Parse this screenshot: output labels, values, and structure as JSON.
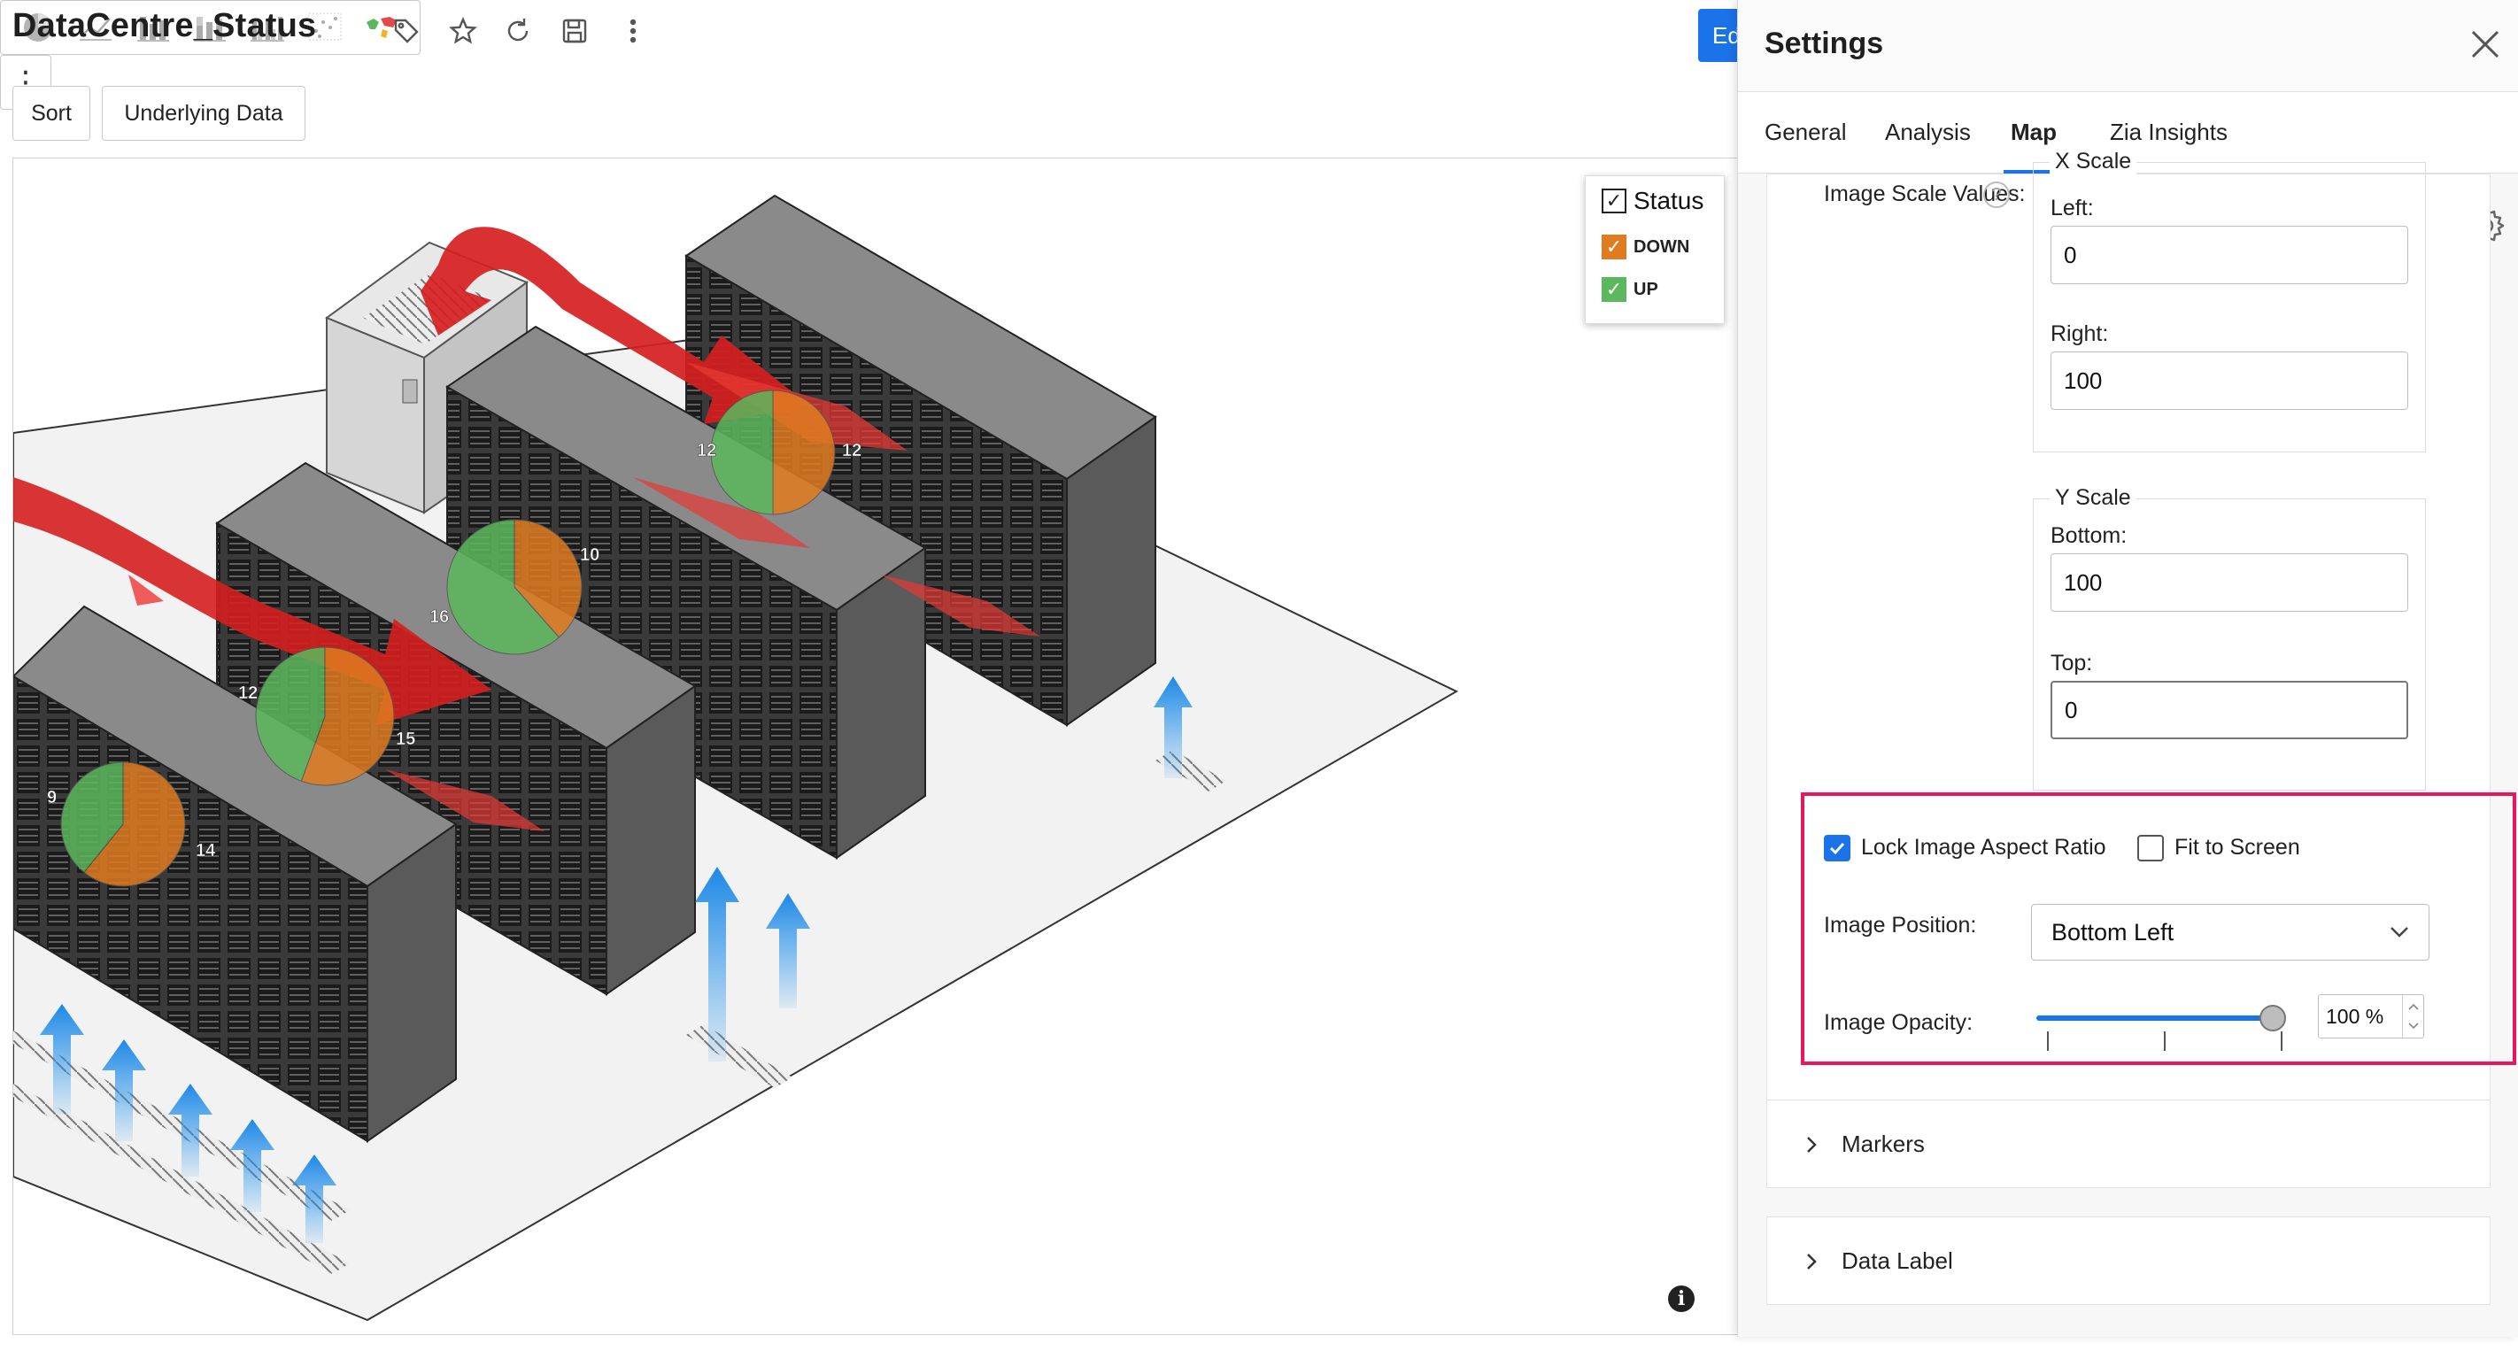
{
  "report": {
    "title": "DataCentre_Status",
    "toolbar": {
      "sort_label": "Sort",
      "underlying_data_label": "Underlying Data",
      "chart_type_icons": [
        "pie-chart-icon",
        "line-chart-icon",
        "bar-chart-icon",
        "stacked-bar-chart-icon",
        "grouped-bar-chart-icon",
        "scatter-chart-icon",
        "map-chart-icon"
      ],
      "edit_label": "Ed"
    },
    "legend": {
      "title": "Status",
      "items": [
        {
          "label": "DOWN",
          "color": "#e07b20"
        },
        {
          "label": "UP",
          "color": "#5cb85c"
        }
      ]
    },
    "pie_markers": [
      {
        "up": 12,
        "down": 12
      },
      {
        "up": 16,
        "down": 10
      },
      {
        "up": 12,
        "down": 15
      },
      {
        "up": 9,
        "down": 14
      }
    ],
    "colors": {
      "up": "#5cb85c",
      "down": "#e07b20",
      "accent": "#1a73e8",
      "highlight": "#e8175d"
    }
  },
  "settings": {
    "title": "Settings",
    "tabs": [
      {
        "label": "General",
        "active": false
      },
      {
        "label": "Analysis",
        "active": false
      },
      {
        "label": "Map",
        "active": true
      },
      {
        "label": "Zia Insights",
        "active": false
      }
    ],
    "image_scale_values_label": "Image Scale Values:",
    "x_scale": {
      "legend": "X Scale",
      "left_label": "Left:",
      "left_value": "0",
      "right_label": "Right:",
      "right_value": "100"
    },
    "y_scale": {
      "legend": "Y Scale",
      "bottom_label": "Bottom:",
      "bottom_value": "100",
      "top_label": "Top:",
      "top_value": "0"
    },
    "lock_aspect": {
      "label": "Lock Image Aspect Ratio",
      "checked": true
    },
    "fit_to_screen": {
      "label": "Fit to Screen",
      "checked": false
    },
    "image_position": {
      "label": "Image Position:",
      "value": "Bottom Left"
    },
    "image_opacity": {
      "label": "Image Opacity:",
      "value": "100 %",
      "level": 1.0
    },
    "sections": [
      {
        "label": "Markers"
      },
      {
        "label": "Data Label"
      }
    ]
  }
}
